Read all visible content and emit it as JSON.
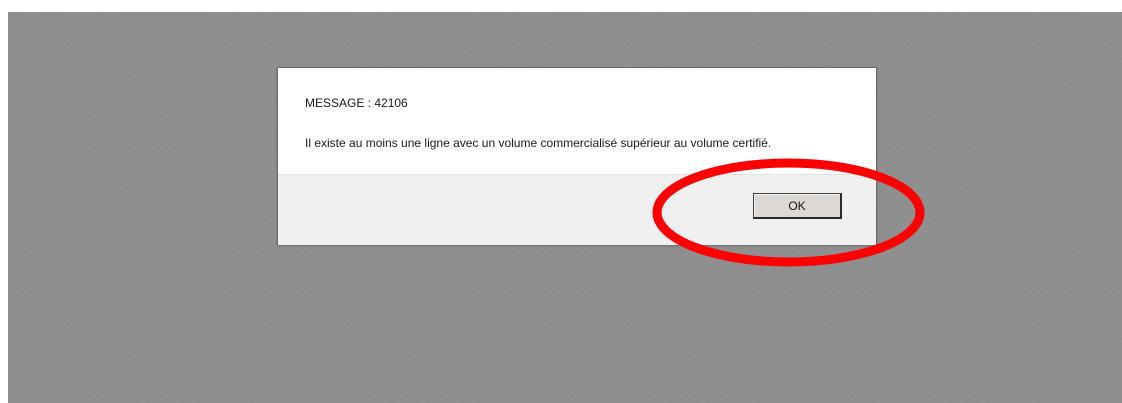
{
  "dialog": {
    "title": "MESSAGE : 42106",
    "message": "Il existe au moins une ligne avec un volume commercialisé supérieur au volume certifié.",
    "ok_label": "OK"
  },
  "colors": {
    "overlay": "#8f8f8f",
    "annotation": "#ff0000"
  }
}
